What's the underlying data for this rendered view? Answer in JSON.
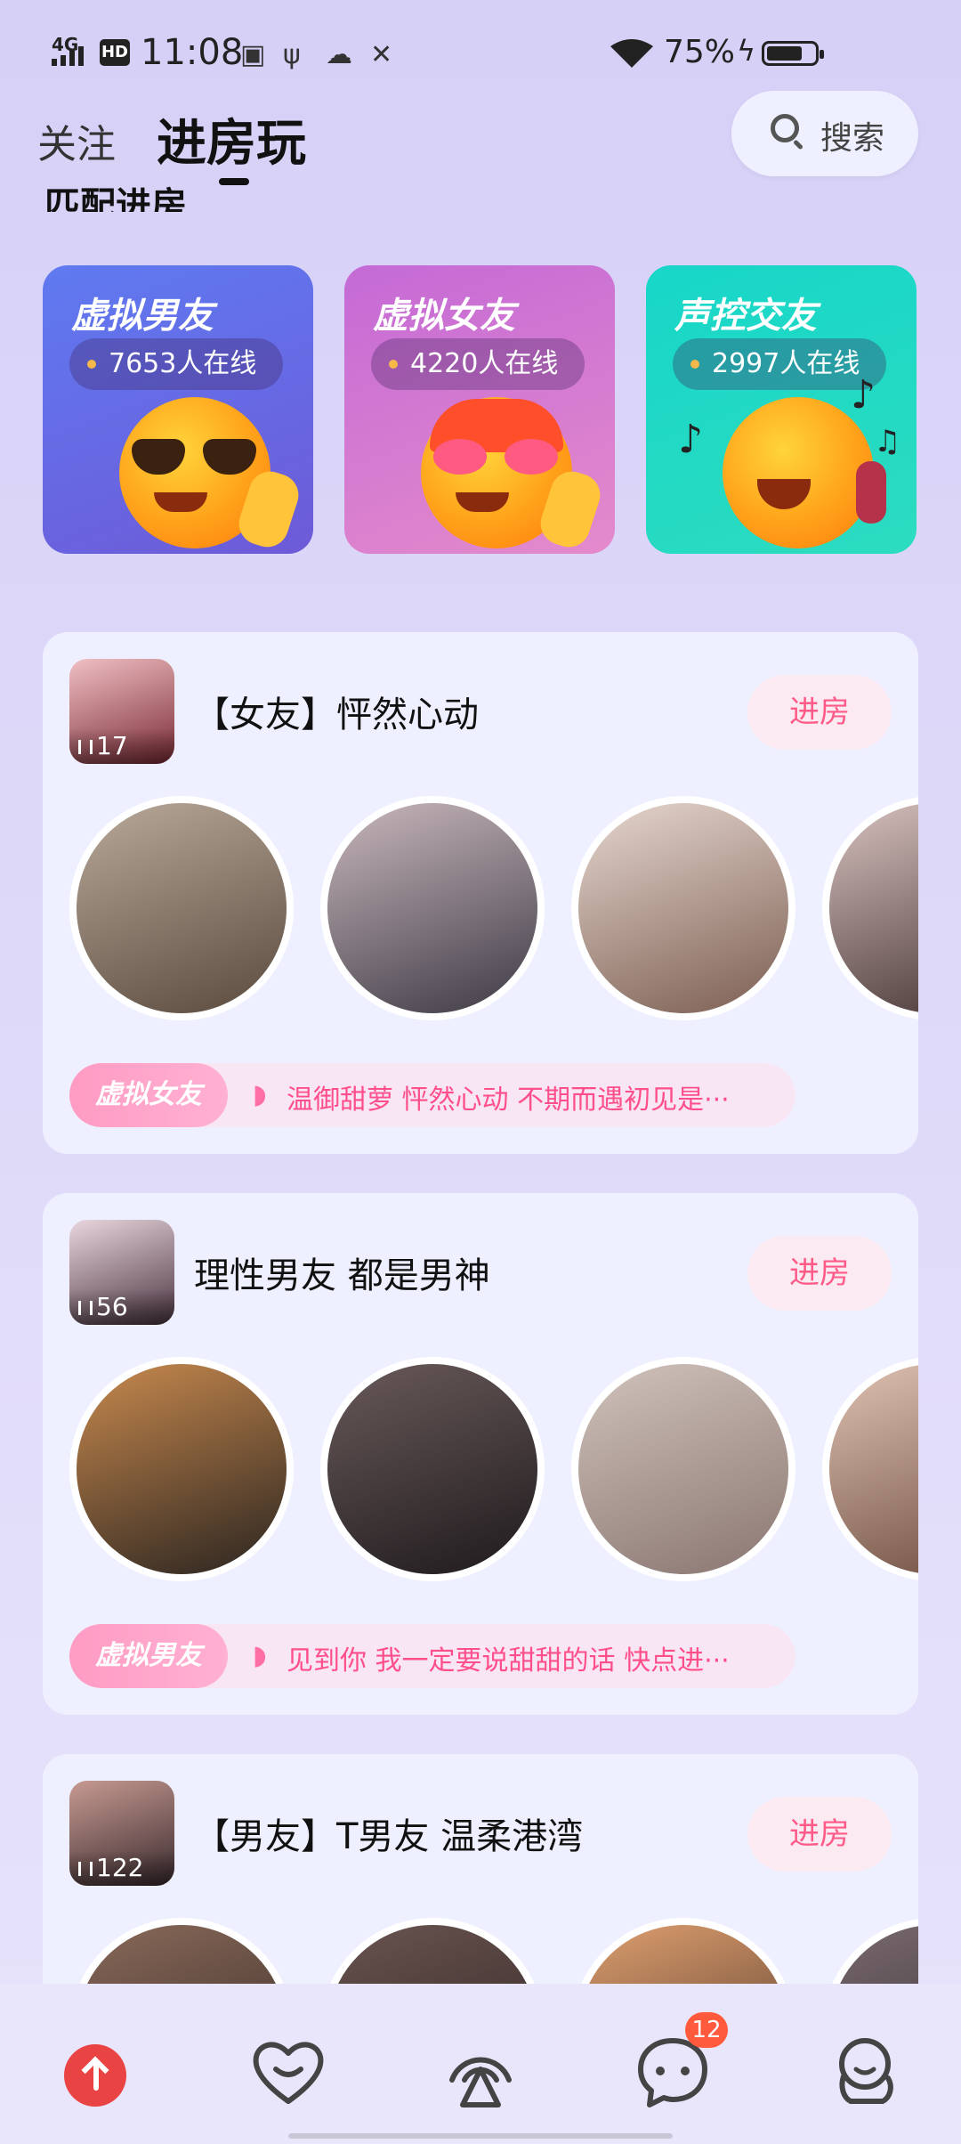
{
  "status_bar": {
    "network": "4G",
    "hd": "HD",
    "time": "11:08",
    "battery_pct": "75%"
  },
  "header": {
    "tabs": [
      {
        "label": "关注",
        "active": false
      },
      {
        "label": "进房玩",
        "active": true
      }
    ],
    "search_label": "搜索",
    "section_label": "匹配进房"
  },
  "categories": [
    {
      "title": "虚拟男友",
      "online": "7653人在线",
      "icon": "sunglasses-emoji-icon"
    },
    {
      "title": "虚拟女友",
      "online": "4220人在线",
      "icon": "heart-glasses-emoji-icon"
    },
    {
      "title": "声控交友",
      "online": "2997人在线",
      "icon": "headphone-emoji-icon"
    }
  ],
  "rooms": [
    {
      "title": "【女友】怦然心动",
      "count": "17",
      "enter": "进房",
      "tag": "虚拟女友",
      "tagline": "温御甜萝 怦然心动 不期而遇初见是···"
    },
    {
      "title": "理性男友 都是男神",
      "count": "56",
      "enter": "进房",
      "tag": "虚拟男友",
      "tagline": "见到你 我一定要说甜甜的话 快点进···"
    },
    {
      "title": "【男友】T男友 温柔港湾",
      "count": "122",
      "enter": "进房"
    }
  ],
  "bottom_nav": {
    "items": [
      "back-to-top-icon",
      "heart-smile-icon",
      "broadcast-icon",
      "chat-icon",
      "profile-icon"
    ],
    "chat_badge": "12"
  },
  "colors": {
    "accent_pink": "#ff5a88",
    "top_button": "#e94343"
  }
}
